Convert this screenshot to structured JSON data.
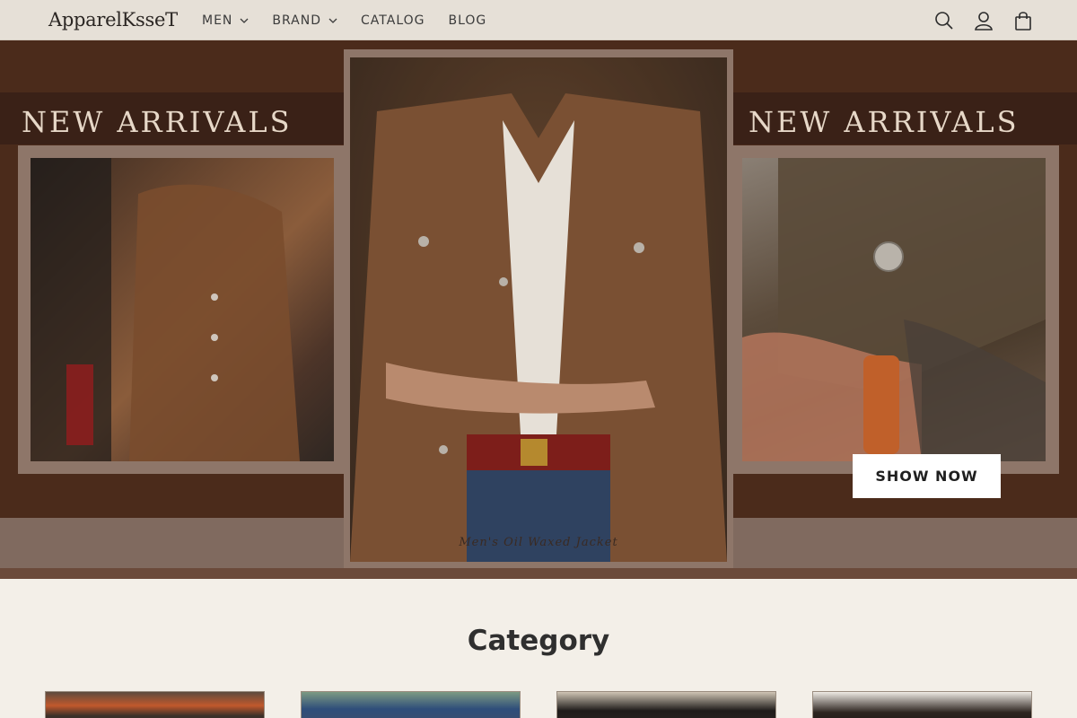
{
  "header": {
    "logo": "ApparelKsseT",
    "nav": [
      {
        "label": "MEN",
        "dropdown": true
      },
      {
        "label": "BRAND",
        "dropdown": true
      },
      {
        "label": "CATALOG",
        "dropdown": false
      },
      {
        "label": "BLOG",
        "dropdown": false
      }
    ],
    "icons": [
      "search-icon",
      "account-icon",
      "cart-icon"
    ]
  },
  "hero": {
    "left_title": "NEW ARRIVALS",
    "right_title": "NEW ARRIVALS",
    "caption": "Men's Oil Waxed Jacket",
    "cta_label": "SHOW NOW"
  },
  "category": {
    "title": "Category"
  },
  "colors": {
    "header_bg": "#e6e0d7",
    "hero_bg": "#4b2b1b",
    "page_bg": "#f3efe8"
  }
}
